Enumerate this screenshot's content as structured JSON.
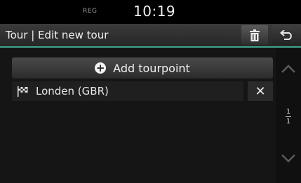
{
  "status": {
    "reg": "REG",
    "clock": "10:19"
  },
  "header": {
    "title": "Tour | Edit new tour"
  },
  "actions": {
    "add_label": "Add tourpoint"
  },
  "tourpoints": [
    {
      "label": "Londen (GBR)",
      "icon": "flag-icon"
    }
  ],
  "pager": {
    "current": "1",
    "total": "1"
  },
  "colors": {
    "accent": "#3fa48e"
  }
}
